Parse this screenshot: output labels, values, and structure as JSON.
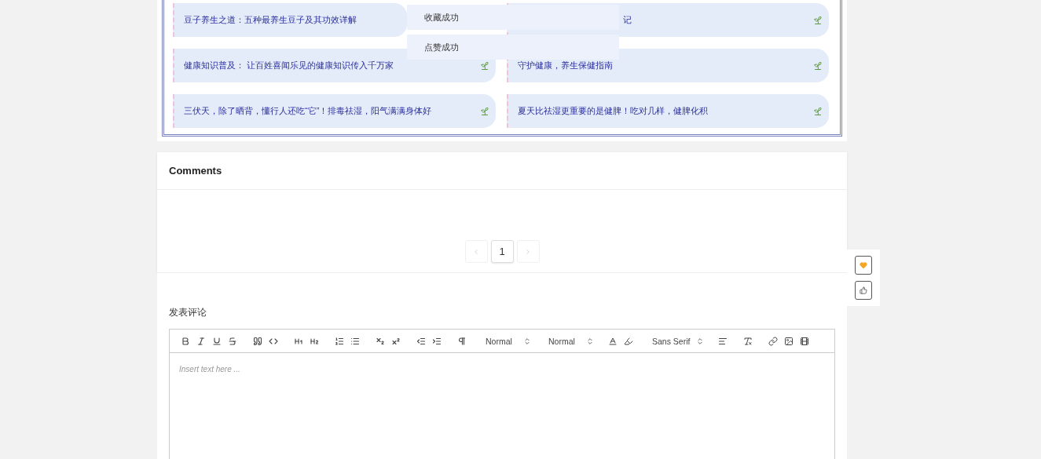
{
  "related_articles": [
    {
      "title": "豆子养生之道：五种最养生豆子及其功效详解",
      "kind": "clipped"
    },
    {
      "title": "记",
      "kind": "partial"
    },
    {
      "title": "健康知识普及： 让百姓喜闻乐见的健康知识传入千万家",
      "kind": "full"
    },
    {
      "title": "守护健康，养生保健指南",
      "kind": "full"
    },
    {
      "title": "三伏天，除了晒背，懂行人还吃“它”！排毒祛湿，阳气满满身体好",
      "kind": "full"
    },
    {
      "title": "夏天比祛湿更重要的是健脾！吃对几样，健脾化积",
      "kind": "full"
    }
  ],
  "toasts": [
    "收藏成功",
    "点赞成功"
  ],
  "comments": {
    "title": "Comments",
    "pagination": [
      {
        "kind": "prev",
        "disabled": true
      },
      {
        "kind": "page",
        "label": "1",
        "selected": true
      },
      {
        "kind": "next",
        "disabled": true
      }
    ]
  },
  "post_comment": {
    "title": "发表评论",
    "dropdowns": [
      "Normal",
      "Normal",
      "Sans Serif"
    ],
    "placeholder": "Insert text here ..."
  },
  "side_actions": [
    {
      "kind": "favorite",
      "selected": true
    },
    {
      "kind": "like",
      "selected": false
    }
  ]
}
